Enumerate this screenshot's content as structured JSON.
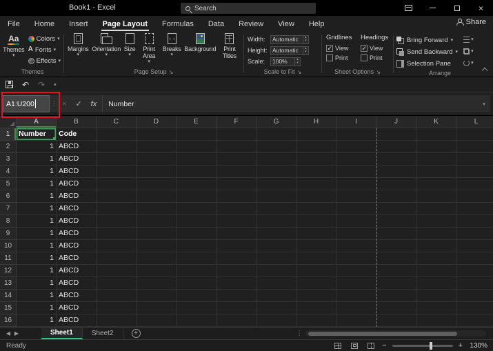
{
  "icons": {
    "dropdown": "▾",
    "spin_up": "▴",
    "spin_down": "▾",
    "dialog_launcher": "↘",
    "undo": "↶",
    "redo": "↷",
    "cancel": "×",
    "enter": "✓",
    "dots": "⋮",
    "close": "×",
    "left_arrow": "◀",
    "right_arrow": "▶",
    "add_sheet": "+",
    "zoom_out": "−",
    "zoom_in": "+",
    "themes_glyph": "Aa",
    "fonts_glyph": "A"
  },
  "titlebar": {
    "title": "Book1 - Excel",
    "search_label": "Search"
  },
  "ribbon_tabs": {
    "items": [
      {
        "label": "File",
        "active": false
      },
      {
        "label": "Home",
        "active": false
      },
      {
        "label": "Insert",
        "active": false
      },
      {
        "label": "Page Layout",
        "active": true
      },
      {
        "label": "Formulas",
        "active": false
      },
      {
        "label": "Data",
        "active": false
      },
      {
        "label": "Review",
        "active": false
      },
      {
        "label": "View",
        "active": false
      },
      {
        "label": "Help",
        "active": false
      }
    ],
    "share_label": "Share"
  },
  "ribbon": {
    "themes": {
      "group_label": "Themes",
      "themes_label": "Themes",
      "colors_label": "Colors",
      "fonts_label": "Fonts",
      "effects_label": "Effects"
    },
    "page_setup": {
      "group_label": "Page Setup",
      "items": [
        {
          "label": "Margins",
          "arrow": true,
          "wrap": false
        },
        {
          "label": "Orientation",
          "arrow": true,
          "wrap": false
        },
        {
          "label": "Size",
          "arrow": true,
          "wrap": false
        },
        {
          "label": "Print Area",
          "arrow": true,
          "wrap": true
        },
        {
          "label": "Breaks",
          "arrow": true,
          "wrap": false
        },
        {
          "label": "Background",
          "arrow": false,
          "wrap": false
        },
        {
          "label": "Print Titles",
          "arrow": false,
          "wrap": true
        }
      ]
    },
    "scale_to_fit": {
      "group_label": "Scale to Fit",
      "width_label": "Width:",
      "width_value": "Automatic",
      "height_label": "Height:",
      "height_value": "Automatic",
      "scale_label": "Scale:",
      "scale_value": "100%"
    },
    "sheet_options": {
      "group_label": "Sheet Options",
      "gridlines_label": "Gridlines",
      "headings_label": "Headings",
      "gridlines_view": {
        "label": "View",
        "checked": true
      },
      "gridlines_print": {
        "label": "Print",
        "checked": false
      },
      "headings_view": {
        "label": "View",
        "checked": true
      },
      "headings_print": {
        "label": "Print",
        "checked": false
      }
    },
    "arrange": {
      "group_label": "Arrange",
      "items": [
        {
          "label": "Bring Forward",
          "arrow": true
        },
        {
          "label": "Send Backward",
          "arrow": true
        },
        {
          "label": "Selection Pane",
          "arrow": false
        }
      ]
    }
  },
  "formula_bar": {
    "name_box_value": "A1:U200",
    "fx_label": "fx",
    "formula_value": "Number"
  },
  "grid": {
    "columns": [
      "A",
      "B",
      "C",
      "D",
      "E",
      "F",
      "G",
      "H",
      "I",
      "J",
      "K",
      "L"
    ],
    "rows": [
      {
        "num": "1",
        "A": "Number",
        "B": "Code",
        "bold": true
      },
      {
        "num": "2",
        "A": "1",
        "B": "ABCD"
      },
      {
        "num": "3",
        "A": "1",
        "B": "ABCD"
      },
      {
        "num": "4",
        "A": "1",
        "B": "ABCD"
      },
      {
        "num": "5",
        "A": "1",
        "B": "ABCD"
      },
      {
        "num": "6",
        "A": "1",
        "B": "ABCD"
      },
      {
        "num": "7",
        "A": "1",
        "B": "ABCD"
      },
      {
        "num": "8",
        "A": "1",
        "B": "ABCD"
      },
      {
        "num": "9",
        "A": "1",
        "B": "ABCD"
      },
      {
        "num": "10",
        "A": "1",
        "B": "ABCD"
      },
      {
        "num": "11",
        "A": "1",
        "B": "ABCD"
      },
      {
        "num": "12",
        "A": "1",
        "B": "ABCD"
      },
      {
        "num": "13",
        "A": "1",
        "B": "ABCD"
      },
      {
        "num": "14",
        "A": "1",
        "B": "ABCD"
      },
      {
        "num": "15",
        "A": "1",
        "B": "ABCD"
      },
      {
        "num": "16",
        "A": "1",
        "B": "ABCD"
      }
    ]
  },
  "sheet_tabs": {
    "tabs": [
      {
        "label": "Sheet1",
        "active": true
      },
      {
        "label": "Sheet2",
        "active": false
      }
    ]
  },
  "status_bar": {
    "ready_label": "Ready",
    "zoom_value": "130%"
  }
}
